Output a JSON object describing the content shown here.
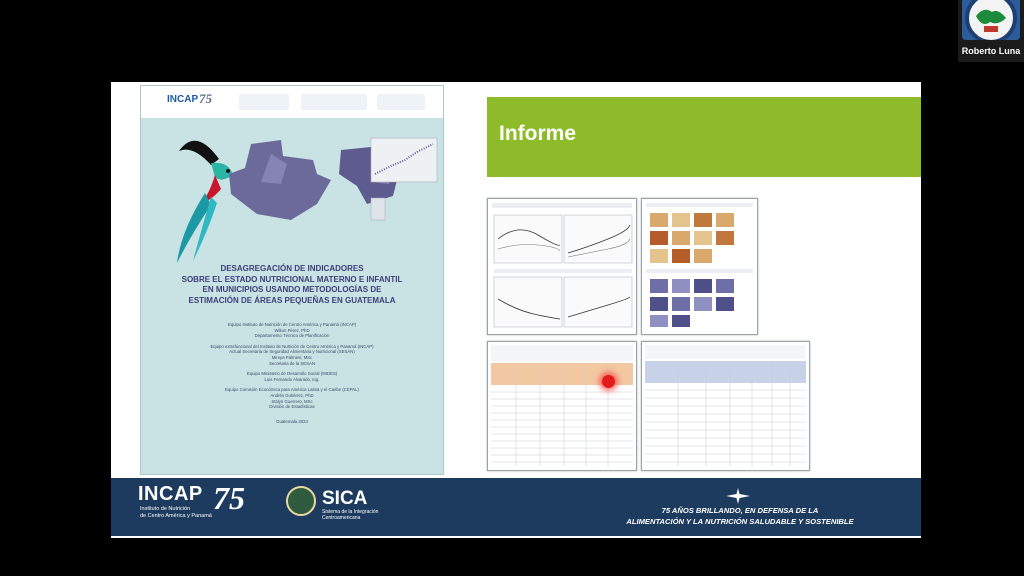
{
  "participant": {
    "name": "Roberto Luna"
  },
  "cover": {
    "header_logo": "INCAP",
    "header_logo_badge": "75",
    "title_lines": [
      "DESAGREGACIÓN DE INDICADORES",
      "SOBRE EL ESTADO NUTRICIONAL MATERNO E INFANTIL",
      "EN MUNICIPIOS USANDO METODOLOGÍAS DE",
      "ESTIMACIÓN DE ÁREAS PEQUEÑAS EN GUATEMALA"
    ],
    "credits": [
      "Equipo Instituto de Nutrición de Centro América y Panamá (INCAP)",
      "Wilton Pérez, PhD",
      "Departamento Técnico de Planificación",
      "",
      "Equipo extrafuncional del Instituto de Nutrición de Centro América y Panamá (INCAP)",
      "Actual Secretaría de Seguridad Alimentaria y Nutricional (SESAN)",
      "Mireya Palmieri, MSc",
      "Secretaria de la SESAN",
      "",
      "Equipo Ministerio de Desarrollo Social (MIDES)",
      "Luis Fernando Alvarado, Ing.",
      "",
      "Equipo Comisión Económica para América Latina y el Caribe (CEPAL)",
      "Andrés Gutiérrez, PhD",
      "Stalyn Guerrero, MSc",
      "División de Estadísticas",
      "",
      "Guatemala 2024"
    ]
  },
  "report": {
    "title": "Informe"
  },
  "footer": {
    "incap_logo": "INCAP",
    "incap_sub_lines": [
      "Instituto de Nutrición",
      "de Centro América y Panamá"
    ],
    "anniversary_mark": "75",
    "sica_logo": "SICA",
    "sica_sub_lines": [
      "Sistema de la Integración",
      "Centroamericana"
    ],
    "tagline_lines": [
      "75 AÑOS BRILLANDO, EN DEFENSA DE LA",
      "ALIMENTACIÓN Y LA NUTRICIÓN SALUDABLE Y SOSTENIBLE"
    ]
  },
  "colors": {
    "banner_green": "#8dbb2a",
    "footer_navy": "#1d3a5f",
    "cover_teal": "#c9e2e3",
    "cover_title": "#3c3f7a",
    "pointer_red": "#e21b1b"
  },
  "icons": [
    "quetzal-bird-icon",
    "guatemala-map-icon",
    "sica-emblem-icon",
    "laser-pointer-icon"
  ]
}
